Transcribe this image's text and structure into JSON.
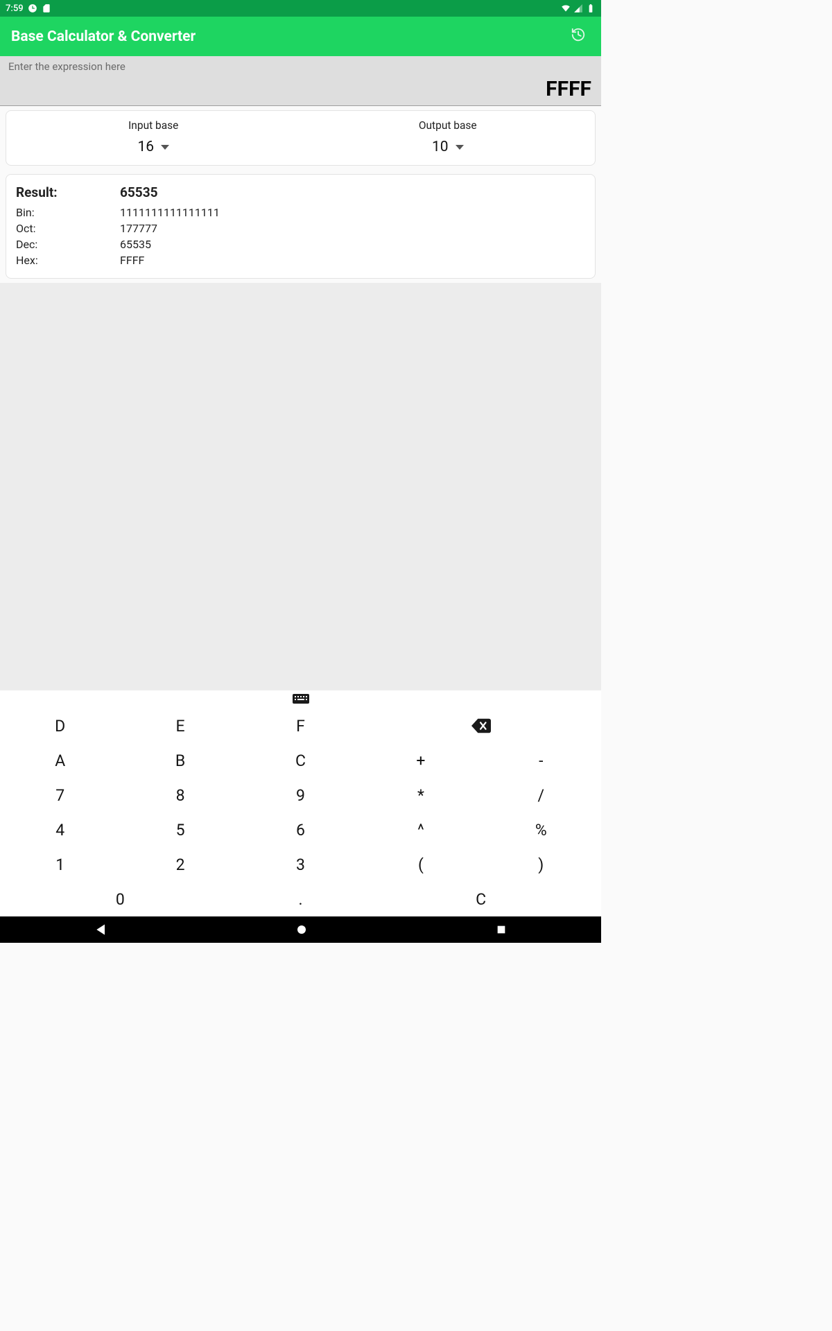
{
  "status": {
    "time": "7:59"
  },
  "app": {
    "title": "Base Calculator & Converter"
  },
  "expression": {
    "placeholder": "Enter the expression here",
    "value": "FFFF"
  },
  "bases": {
    "input_label": "Input base",
    "input_value": "16",
    "output_label": "Output base",
    "output_value": "10"
  },
  "result": {
    "label": "Result:",
    "value": "65535",
    "bin_label": "Bin:",
    "bin": "1111111111111111",
    "oct_label": "Oct:",
    "oct": "177777",
    "dec_label": "Dec:",
    "dec": "65535",
    "hex_label": "Hex:",
    "hex": "FFFF"
  },
  "keys": {
    "D": "D",
    "E": "E",
    "F": "F",
    "A": "A",
    "B": "B",
    "C": "C",
    "plus": "+",
    "minus": "-",
    "7": "7",
    "8": "8",
    "9": "9",
    "star": "*",
    "slash": "/",
    "4": "4",
    "5": "5",
    "6": "6",
    "caret": "^",
    "percent": "%",
    "1": "1",
    "2": "2",
    "3": "3",
    "lpar": "(",
    "rpar": ")",
    "0": "0",
    "dot": ".",
    "clear": "C"
  }
}
